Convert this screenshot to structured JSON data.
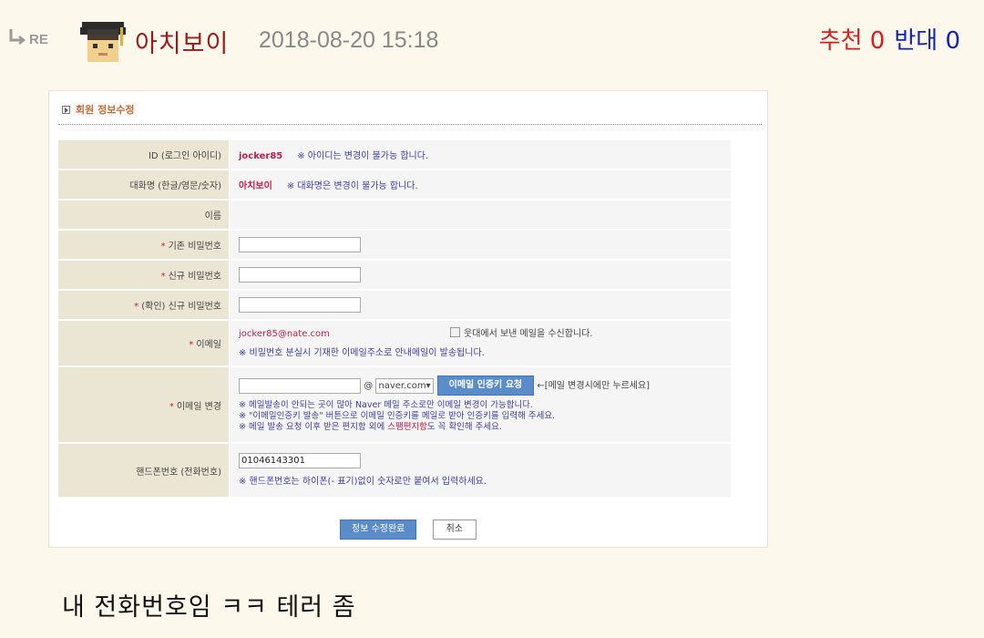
{
  "header": {
    "re_label": "RE",
    "nickname": "아치보이",
    "datetime": "2018-08-20 15:18",
    "recommend_label": "추천",
    "recommend_count": "0",
    "oppose_label": "반대",
    "oppose_count": "0"
  },
  "screenshot": {
    "section_title": "회원 정보수정",
    "rows": {
      "id": {
        "label": "ID (로그인 아이디)",
        "value": "jocker85",
        "note": "※ 아이디는 변경이 불가능 합니다."
      },
      "nick": {
        "label": "대화명 (한글/영문/숫자)",
        "value": "아치보이",
        "note": "※ 대화명은 변경이 불가능 합니다."
      },
      "name": {
        "label": "이름",
        "value": ""
      },
      "cur_pw": {
        "label": "기존 비밀번호",
        "required_mark": "*"
      },
      "new_pw": {
        "label": "신규 비밀번호",
        "required_mark": "*"
      },
      "confirm_pw": {
        "label": "(확인) 신규 비밀번호",
        "required_mark": "*"
      },
      "email": {
        "label": "이메일",
        "required_mark": "*",
        "value": "jocker85@nate.com",
        "checkbox_label": "웃대에서 보낸 메일을 수신합니다.",
        "note": "※ 비밀번호 분실시 기재한 이메일주소로 안내메일이 발송됩니다."
      },
      "email_change": {
        "label": "이메일 변경",
        "required_mark": "*",
        "at": "@",
        "domain_option": "naver.com",
        "domain_arrow": "▾",
        "request_button": "이메일 인증키 요청",
        "button_hint": "←[메일 변경시에만 누르세요]",
        "note1": "※ 메일발송이 안되는 곳이 많아 Naver 메일 주소로만 이메일 변경이 가능합니다.",
        "note2": "※ \"이메일인증키 발송\" 버튼으로 이메일 인증키를 메일로 받아 인증키를 입력해 주세요.",
        "note3_before": "※ 메일 발송 요청 이후 받은 편지함 외에 ",
        "note3_highlight": "스팸편지함",
        "note3_after": "도 꼭 확인해 주세요."
      },
      "phone": {
        "label": "핸드폰번호 (전화번호)",
        "value": "01046143301",
        "note": "※ 핸드폰번호는 하이폰(- 표기)없이 숫자로만 붙여서 입력하세요."
      }
    },
    "save_button": "정보 수정완료",
    "cancel_button": "취소"
  },
  "comment": "내 전화번호임 ㅋㅋ 테러 좀",
  "colors": {
    "background": "#fdf8ec",
    "nickname": "#9b1b1b",
    "recommend": "#dd1c1c",
    "oppose": "#1222b8",
    "button_blue": "#5a8cc9",
    "label_cell": "#ebe5d4"
  }
}
